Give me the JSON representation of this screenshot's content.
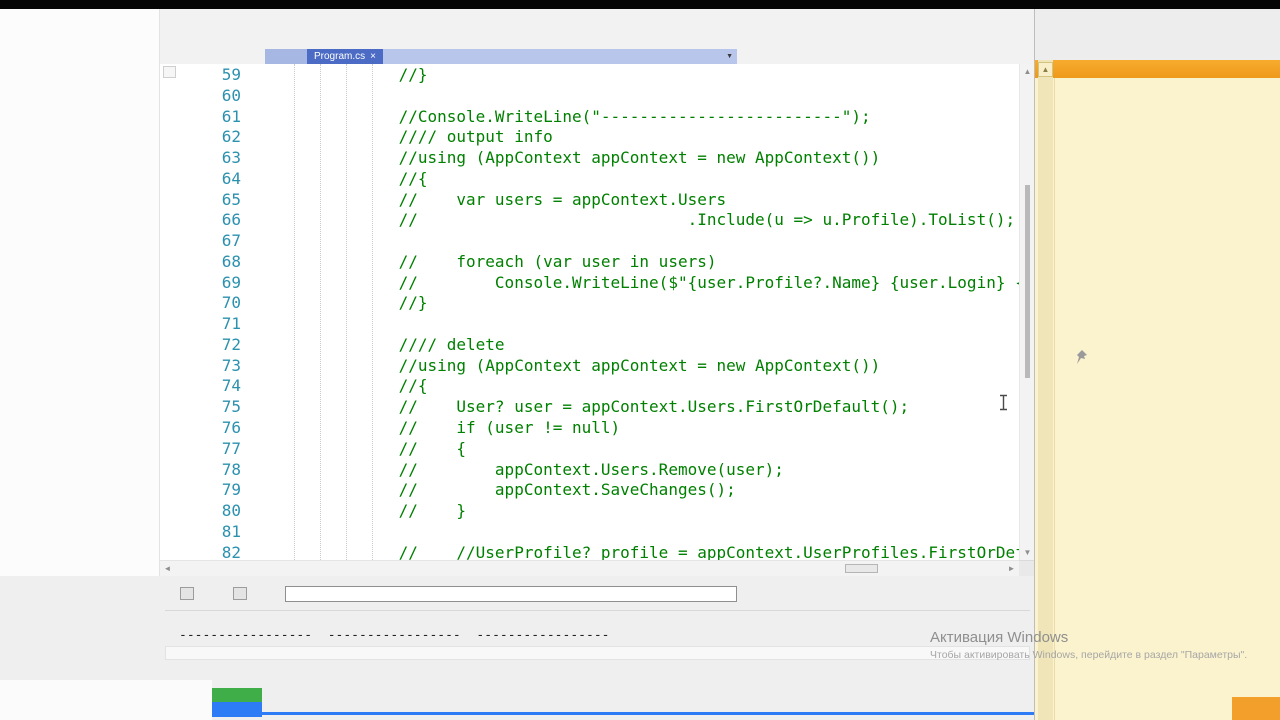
{
  "tabs": {
    "active": {
      "label": "Program.cs",
      "close_glyph": "×"
    },
    "overflow_glyph": "▼"
  },
  "editor": {
    "scrollbar_glyphs": {
      "up": "▲",
      "down": "▼",
      "left": "◄",
      "right": "►"
    },
    "lines": [
      {
        "num": "59",
        "code": "            //}"
      },
      {
        "num": "60",
        "code": ""
      },
      {
        "num": "61",
        "code": "            //Console.WriteLine(\"-------------------------\");"
      },
      {
        "num": "62",
        "code": "            //// output info"
      },
      {
        "num": "63",
        "code": "            //using (AppContext appContext = new AppContext())"
      },
      {
        "num": "64",
        "code": "            //{"
      },
      {
        "num": "65",
        "code": "            //    var users = appContext.Users"
      },
      {
        "num": "66",
        "code": "            //                            .Include(u => u.Profile).ToList();"
      },
      {
        "num": "67",
        "code": ""
      },
      {
        "num": "68",
        "code": "            //    foreach (var user in users)"
      },
      {
        "num": "69",
        "code": "            //        Console.WriteLine($\"{user.Profile?.Name} {user.Login} {"
      },
      {
        "num": "70",
        "code": "            //}"
      },
      {
        "num": "71",
        "code": ""
      },
      {
        "num": "72",
        "code": "            //// delete"
      },
      {
        "num": "73",
        "code": "            //using (AppContext appContext = new AppContext())"
      },
      {
        "num": "74",
        "code": "            //{"
      },
      {
        "num": "75",
        "code": "            //    User? user = appContext.Users.FirstOrDefault();"
      },
      {
        "num": "76",
        "code": "            //    if (user != null)"
      },
      {
        "num": "77",
        "code": "            //    {"
      },
      {
        "num": "78",
        "code": "            //        appContext.Users.Remove(user);"
      },
      {
        "num": "79",
        "code": "            //        appContext.SaveChanges();"
      },
      {
        "num": "80",
        "code": "            //    }"
      },
      {
        "num": "81",
        "code": ""
      },
      {
        "num": "82",
        "code": "            //    //UserProfile? profile = appContext.UserProfiles.FirstOrDef"
      }
    ]
  },
  "console": {
    "input_value": "",
    "output_dashes": "-----------------  -----------------  -----------------"
  },
  "watermark": {
    "title": "Активация Windows",
    "subtitle": "Чтобы активировать Windows, перейдите в раздел \"Параметры\"."
  },
  "colors": {
    "active_tab_blue": "#4b6bc4",
    "tab_band": "#b9c6ec",
    "comment_green": "#008000",
    "line_number_teal": "#2b91af",
    "panel_orange": "#f2a02b",
    "panel_cream": "#fbf3cd",
    "accent_blue": "#2e7cf5",
    "accent_green": "#3fae49"
  }
}
